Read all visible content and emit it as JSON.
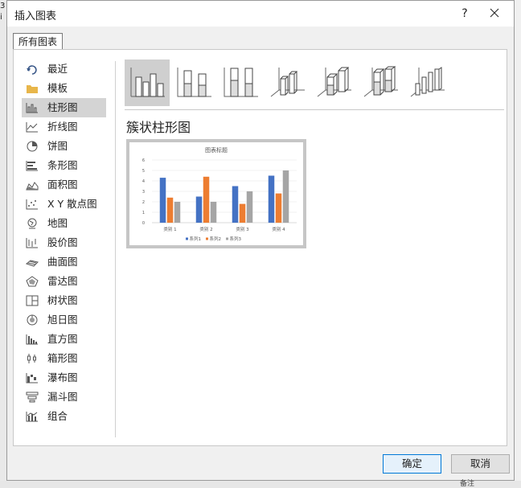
{
  "dialog": {
    "title": "插入图表",
    "help_label": "?",
    "tab_label": "所有图表",
    "ok_label": "确定",
    "cancel_label": "取消"
  },
  "background": {
    "left_fragments": [
      "3",
      "i"
    ],
    "notes_label": "备注"
  },
  "categories": [
    {
      "label": "最近",
      "icon": "recent-icon"
    },
    {
      "label": "模板",
      "icon": "template-folder-icon"
    },
    {
      "label": "柱形图",
      "icon": "column-chart-icon",
      "selected": true
    },
    {
      "label": "折线图",
      "icon": "line-chart-icon"
    },
    {
      "label": "饼图",
      "icon": "pie-chart-icon"
    },
    {
      "label": "条形图",
      "icon": "bar-chart-icon"
    },
    {
      "label": "面积图",
      "icon": "area-chart-icon"
    },
    {
      "label": "X Y 散点图",
      "icon": "scatter-chart-icon"
    },
    {
      "label": "地图",
      "icon": "map-chart-icon"
    },
    {
      "label": "股价图",
      "icon": "stock-chart-icon"
    },
    {
      "label": "曲面图",
      "icon": "surface-chart-icon"
    },
    {
      "label": "雷达图",
      "icon": "radar-chart-icon"
    },
    {
      "label": "树状图",
      "icon": "treemap-chart-icon"
    },
    {
      "label": "旭日图",
      "icon": "sunburst-chart-icon"
    },
    {
      "label": "直方图",
      "icon": "histogram-chart-icon"
    },
    {
      "label": "箱形图",
      "icon": "box-whisker-chart-icon"
    },
    {
      "label": "瀑布图",
      "icon": "waterfall-chart-icon"
    },
    {
      "label": "漏斗图",
      "icon": "funnel-chart-icon"
    },
    {
      "label": "组合",
      "icon": "combo-chart-icon"
    }
  ],
  "subtypes": [
    {
      "icon": "clustered-column-icon",
      "selected": true
    },
    {
      "icon": "stacked-column-icon"
    },
    {
      "icon": "percent-stacked-column-icon"
    },
    {
      "icon": "3d-clustered-column-icon"
    },
    {
      "icon": "3d-stacked-column-icon"
    },
    {
      "icon": "3d-percent-stacked-column-icon"
    },
    {
      "icon": "3d-column-icon"
    }
  ],
  "selected_subtype_title": "簇状柱形图",
  "colors": {
    "series1": "#4472c4",
    "series2": "#ed7d31",
    "series3": "#a5a5a5",
    "ok_border": "#0078d7",
    "selected_bg": "#d4d4d4"
  },
  "chart_data": {
    "type": "bar",
    "title": "图表标题",
    "categories": [
      "类别 1",
      "类别 2",
      "类别 3",
      "类别 4"
    ],
    "series": [
      {
        "name": "系列1",
        "values": [
          4.3,
          2.5,
          3.5,
          4.5
        ]
      },
      {
        "name": "系列2",
        "values": [
          2.4,
          4.4,
          1.8,
          2.8
        ]
      },
      {
        "name": "系列3",
        "values": [
          2,
          2,
          3,
          5
        ]
      }
    ],
    "yticks": [
      "0",
      "1",
      "2",
      "3",
      "4",
      "5",
      "6"
    ],
    "ylim": [
      0,
      6
    ],
    "grid": true,
    "legend": "bottom"
  }
}
